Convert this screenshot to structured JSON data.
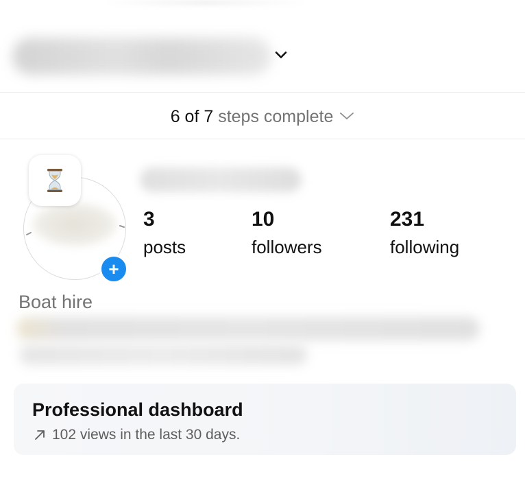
{
  "header": {
    "chevron_icon": "chevron-down-icon"
  },
  "steps": {
    "count": "6 of 7",
    "label": "steps complete",
    "chevron_icon": "chevron-down-icon"
  },
  "profile": {
    "note_icon": "hourglass-icon",
    "add_icon": "plus-icon",
    "stats": [
      {
        "value": "3",
        "label": "posts"
      },
      {
        "value": "10",
        "label": "followers"
      },
      {
        "value": "231",
        "label": "following"
      }
    ],
    "category": "Boat hire"
  },
  "dashboard": {
    "title": "Professional dashboard",
    "trend_icon": "arrow-up-right-icon",
    "subtitle": "102 views in the last 30 days."
  },
  "colors": {
    "accent": "#1a8cf0",
    "secondary_text": "#737373",
    "card_background": "#f4f6f9"
  }
}
